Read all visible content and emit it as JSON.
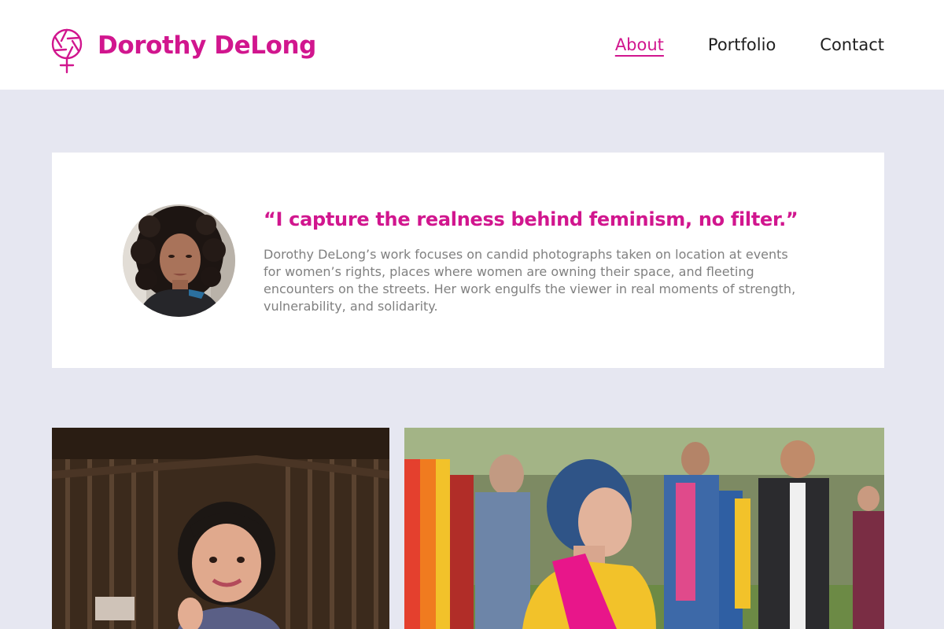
{
  "header": {
    "brand": "Dorothy DeLong",
    "logo_icon": "camera-shutter-female-symbol-icon",
    "nav": [
      {
        "label": "About",
        "active": true
      },
      {
        "label": "Portfolio",
        "active": false
      },
      {
        "label": "Contact",
        "active": false
      }
    ]
  },
  "intro": {
    "quote": "“I capture the realness behind feminism, no filter.”",
    "bio": "Dorothy DeLong’s work focuses on candid photographs taken on location at events for women’s rights, places where women are owning their space, and fleeting encounters on the streets. Her work engulfs the viewer in real moments of strength, vulnerability, and solidarity."
  },
  "colors": {
    "accent": "#d1168e",
    "page_background": "#e6e7f1",
    "body_text": "#808080"
  }
}
